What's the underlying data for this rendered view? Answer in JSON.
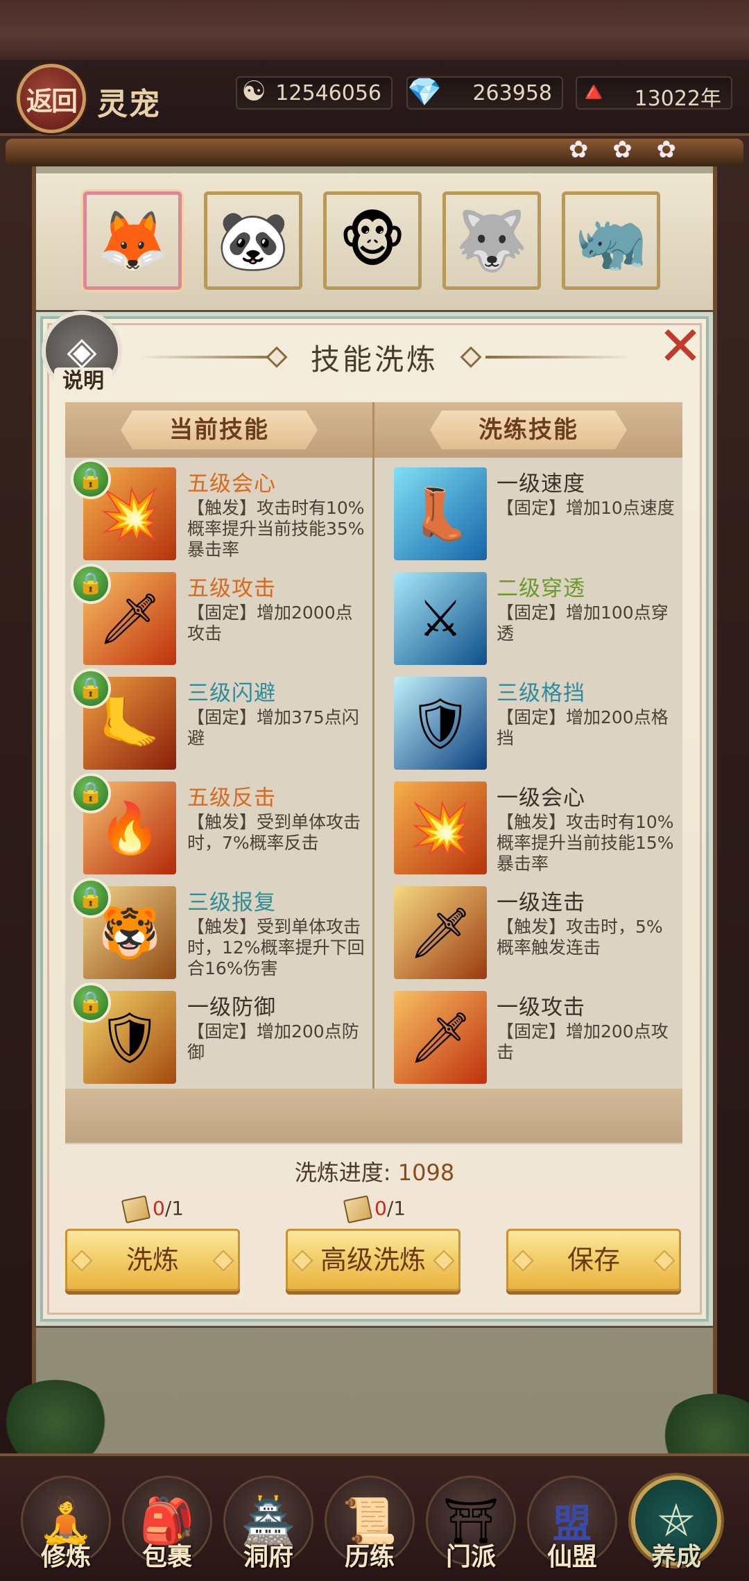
{
  "header": {
    "back_label": "返回",
    "title": "灵宠",
    "resources": [
      {
        "icon": "taiji-coin-icon",
        "glyph": "☯",
        "value": "12546056"
      },
      {
        "icon": "crystal-icon",
        "glyph": "💎",
        "value": "263958"
      },
      {
        "icon": "cultivation-years-icon",
        "glyph": "🔺",
        "value": "13022年"
      }
    ]
  },
  "pets": [
    {
      "name": "white-fox",
      "glyph": "🦊",
      "selected": true
    },
    {
      "name": "panda",
      "glyph": "🐼",
      "selected": false
    },
    {
      "name": "monkey",
      "glyph": "🐵",
      "selected": false
    },
    {
      "name": "wolf",
      "glyph": "🐺",
      "selected": false
    },
    {
      "name": "armored-beast",
      "glyph": "🦏",
      "selected": false
    }
  ],
  "dialog": {
    "help_label": "说明",
    "title": "技能洗炼",
    "current_header": "当前技能",
    "refine_header": "洗练技能",
    "current_skills": [
      {
        "name": "五级会心",
        "desc": "【触发】攻击时有10%概率提升当前技能35%暴击率",
        "color": "orange",
        "icon": "critical-strike-icon",
        "glyph": "💥",
        "locked": true
      },
      {
        "name": "五级攻击",
        "desc": "【固定】增加2000点攻击",
        "color": "orange",
        "icon": "flaming-sword-icon",
        "glyph": "🗡",
        "locked": true
      },
      {
        "name": "三级闪避",
        "desc": "【固定】增加375点闪避",
        "color": "teal",
        "icon": "dodge-boot-icon",
        "glyph": "🦶",
        "locked": true
      },
      {
        "name": "五级反击",
        "desc": "【触发】受到单体攻击时，7%概率反击",
        "color": "orange",
        "icon": "counterattack-icon",
        "glyph": "🔥",
        "locked": true
      },
      {
        "name": "三级报复",
        "desc": "【触发】受到单体攻击时，12%概率提升下回合16%伤害",
        "color": "teal",
        "icon": "retaliation-beast-icon",
        "glyph": "🐯",
        "locked": true
      },
      {
        "name": "一级防御",
        "desc": "【固定】增加200点防御",
        "color": "dark",
        "icon": "shield-icon",
        "glyph": "🛡",
        "locked": true
      }
    ],
    "refine_skills": [
      {
        "name": "一级速度",
        "desc": "【固定】增加10点速度",
        "color": "dark",
        "icon": "speed-boot-icon",
        "glyph": "👢"
      },
      {
        "name": "二级穿透",
        "desc": "【固定】增加100点穿透",
        "color": "green",
        "icon": "penetration-icon",
        "glyph": "⚔"
      },
      {
        "name": "三级格挡",
        "desc": "【固定】增加200点格挡",
        "color": "teal",
        "icon": "block-icon",
        "glyph": "🛡"
      },
      {
        "name": "一级会心",
        "desc": "【触发】攻击时有10%概率提升当前技能15%暴击率",
        "color": "dark",
        "icon": "critical-strike-icon",
        "glyph": "💥"
      },
      {
        "name": "一级连击",
        "desc": "【触发】攻击时，5%概率触发连击",
        "color": "dark",
        "icon": "combo-blades-icon",
        "glyph": "🗡"
      },
      {
        "name": "一级攻击",
        "desc": "【固定】增加200点攻击",
        "color": "dark",
        "icon": "flaming-sword-icon",
        "glyph": "🗡"
      }
    ],
    "progress_label": "洗炼进度:",
    "progress_value": "1098",
    "costs": [
      {
        "have": "0",
        "need": "/1"
      },
      {
        "have": "0",
        "need": "/1"
      }
    ],
    "buttons": {
      "refine": "洗炼",
      "advanced_refine": "高级洗炼",
      "save": "保存"
    },
    "close_glyph": "✕"
  },
  "bottom_nav": [
    {
      "label": "修炼",
      "glyph": "🧘",
      "icon": "cultivate-icon",
      "active": false
    },
    {
      "label": "包裹",
      "glyph": "🎒",
      "icon": "bag-icon",
      "active": false
    },
    {
      "label": "洞府",
      "glyph": "🏯",
      "icon": "cave-dwelling-icon",
      "active": false
    },
    {
      "label": "历练",
      "glyph": "📜",
      "icon": "training-scroll-icon",
      "active": false
    },
    {
      "label": "门派",
      "glyph": "⛩",
      "icon": "sect-gate-icon",
      "active": false
    },
    {
      "label": "仙盟",
      "glyph": "盟",
      "icon": "alliance-icon",
      "active": false
    },
    {
      "label": "养成",
      "glyph": "⛤",
      "icon": "pentagram-icon",
      "active": true
    }
  ],
  "colors": {
    "orange": "#d76a1d",
    "teal": "#2c8d9b",
    "green": "#6a9a2a",
    "dark": "#3c3128",
    "button_gold": "#f3cf6a",
    "lock_green": "#3f8c2f"
  }
}
